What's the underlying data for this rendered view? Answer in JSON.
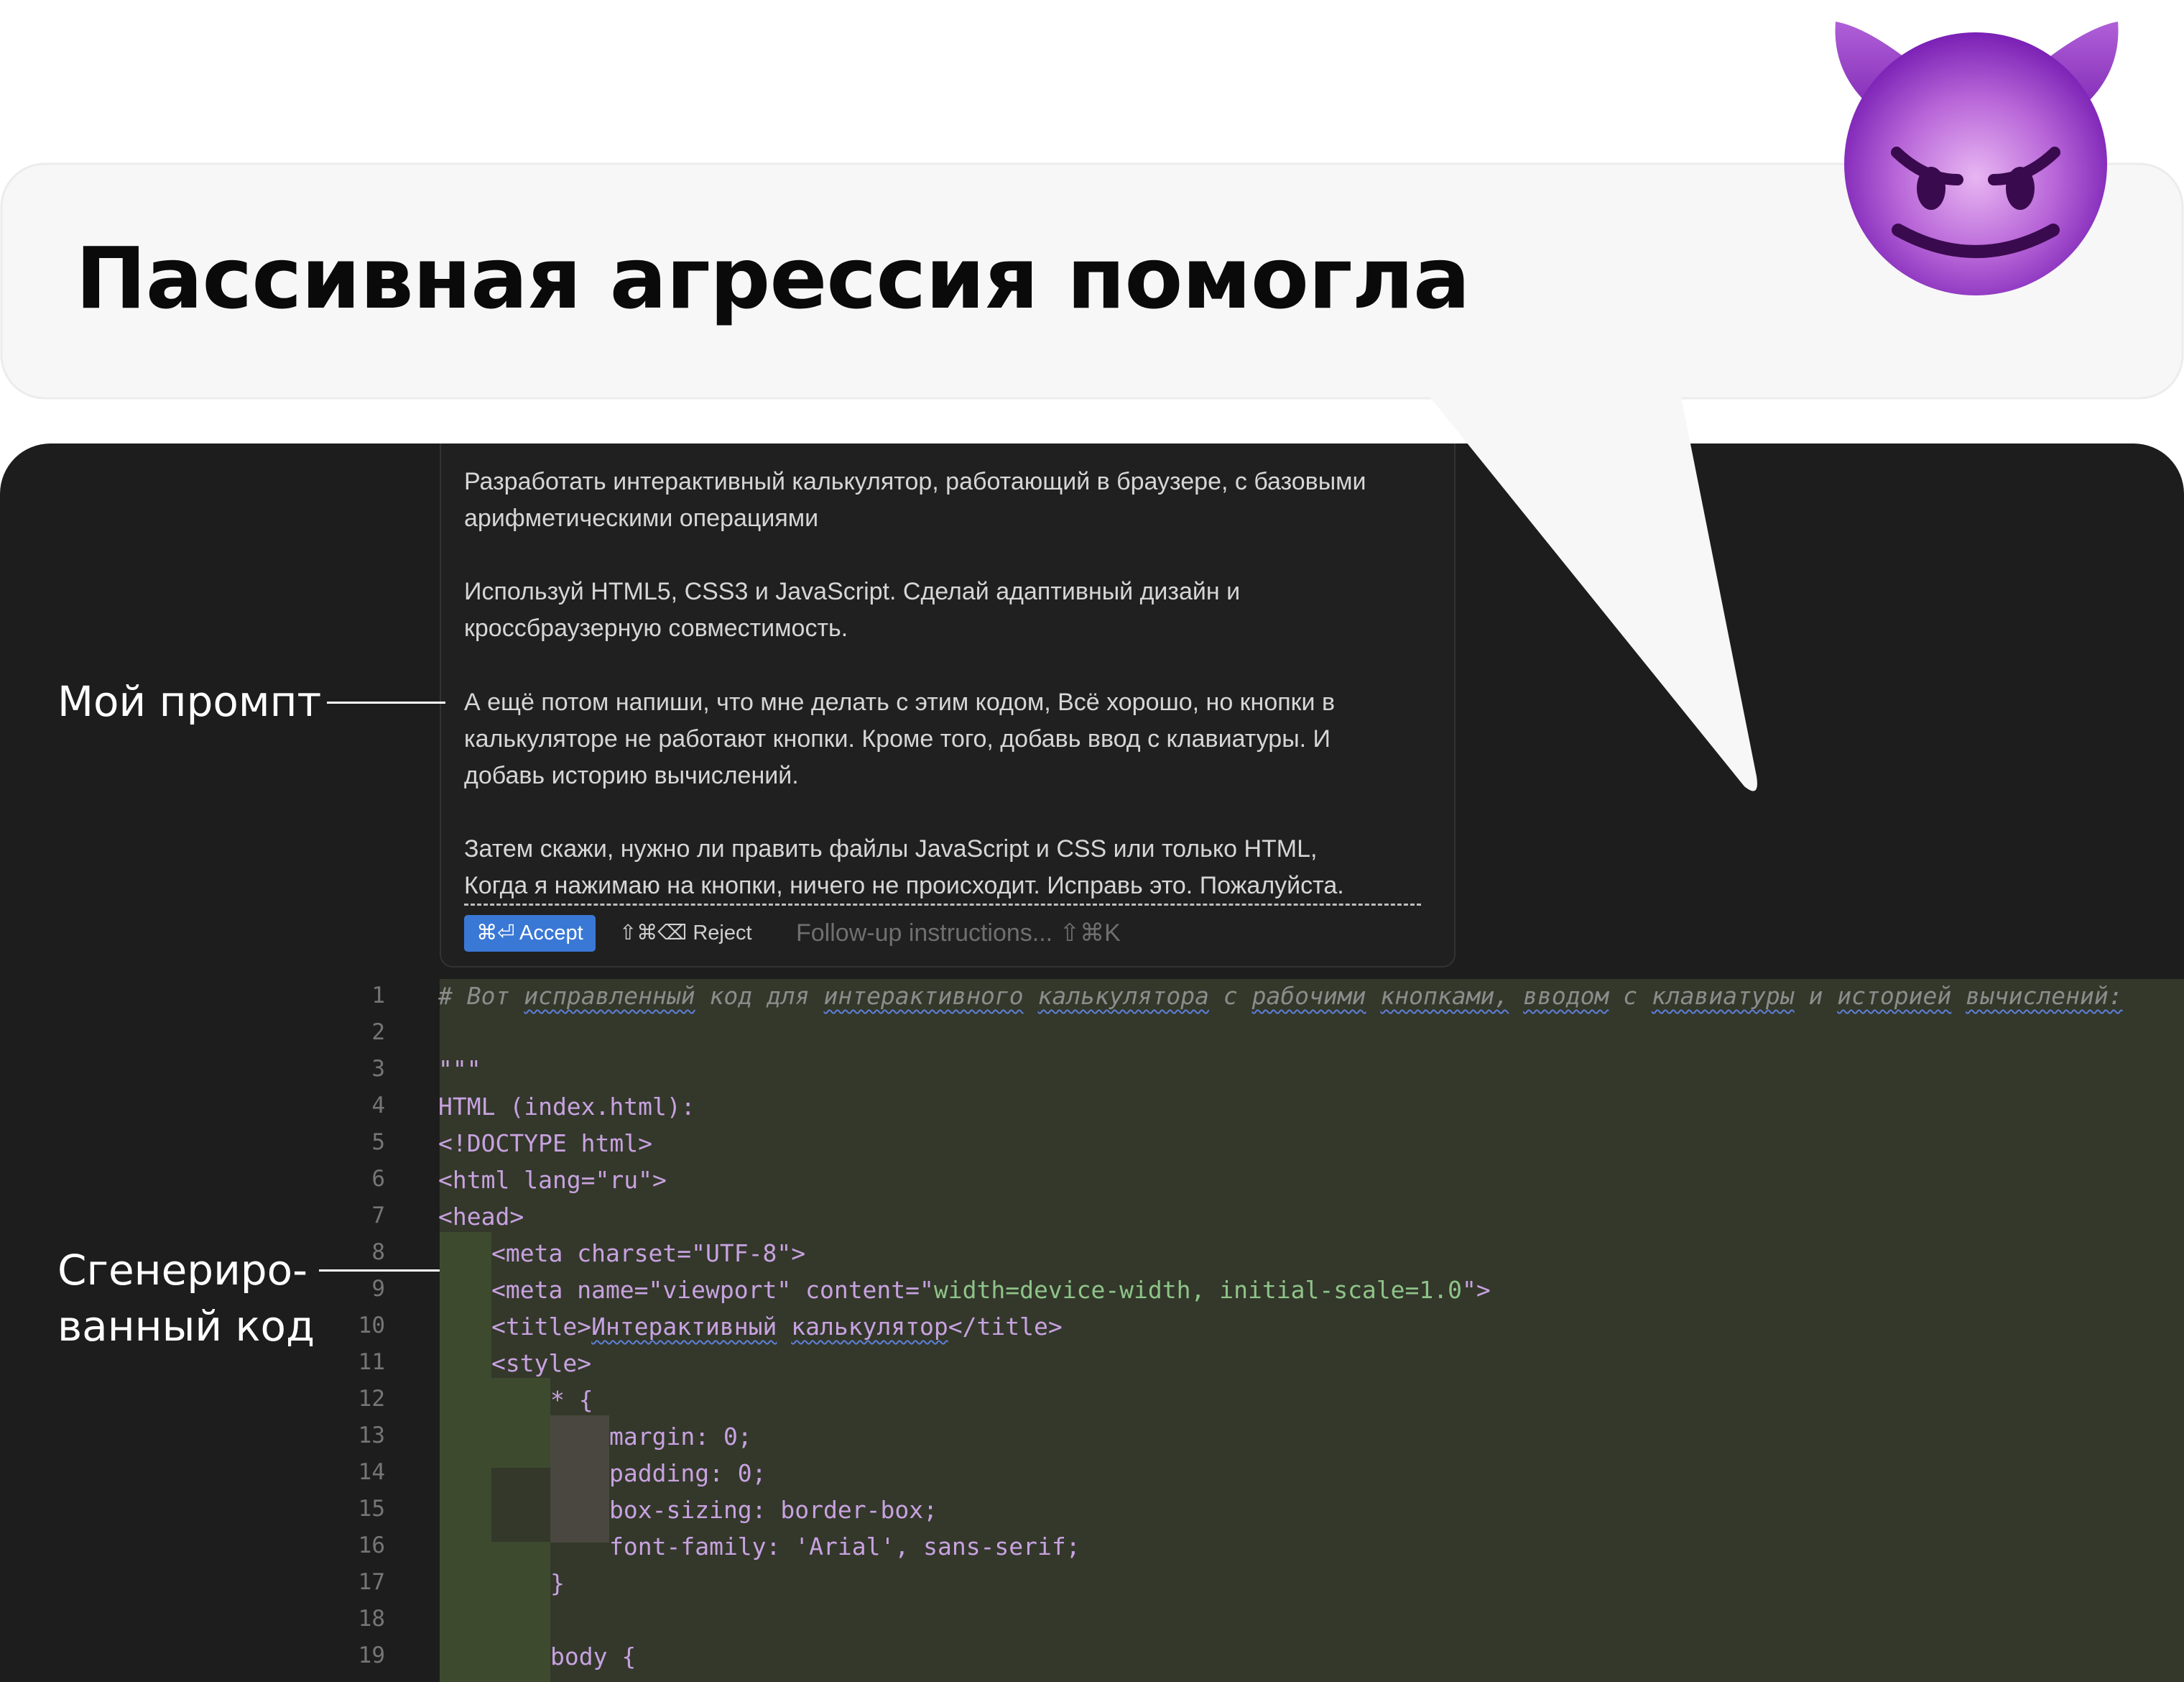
{
  "header": {
    "title": "Пассивная агрессия помогла",
    "emoji": "smiling-face-with-horns"
  },
  "annotations": {
    "prompt_label": "Мой промпт",
    "code_label_line1": "Сгенериро-",
    "code_label_line2": "ванный код"
  },
  "prompt": {
    "p1_l1": "Разработать интерактивный калькулятор, работающий в браузере, с базовыми",
    "p1_l2": "арифметическими операциями",
    "p2_l1": "Используй HTML5, CSS3 и JavaScript. Сделай адаптивный дизайн и",
    "p2_l2": "кроссбраузерную совместимость.",
    "p3_l1": "А ещё потом напиши, что мне делать с этим кодом, Всё хорошо, но кнопки в",
    "p3_l2": "калькуляторе не работают кнопки. Кроме того, добавь ввод с клавиатуры. И",
    "p3_l3": "добавь историю вычислений.",
    "p4_l1": "Затем скажи, нужно ли править файлы JavaScript и CSS или только HTML,",
    "p4_l2": "Когда я нажимаю на кнопки, ничего не происходит. Исправь это. Пожалуйста."
  },
  "actions": {
    "accept_label": "⌘⏎ Accept",
    "reject_label": "⇧⌘⌫ Reject",
    "followup_placeholder": "Follow-up instructions... ⇧⌘K"
  },
  "code": {
    "line_numbers": [
      "1",
      "2",
      "3",
      "4",
      "5",
      "6",
      "7",
      "8",
      "9",
      "10",
      "11",
      "12",
      "13",
      "14",
      "15",
      "16",
      "17",
      "18",
      "19"
    ],
    "l1_w1": "Вот",
    "l1_w2": "исправленный",
    "l1_w3": "код",
    "l1_w4": "для",
    "l1_w5": "интерактивного",
    "l1_w6": "калькулятора",
    "l1_w7": "с",
    "l1_w8": "рабочими",
    "l1_w9": "кнопками,",
    "l1_w10": "вводом",
    "l1_w11": "с",
    "l1_w12": "клавиатуры",
    "l1_w13": "и",
    "l1_w14": "историей",
    "l1_w15": "вычислений:",
    "l3": "\"\"\"",
    "l4": "HTML (index.html):",
    "l5": "<!DOCTYPE html>",
    "l6": "<html lang=\"ru\">",
    "l7": "<head>",
    "l8": "<meta charset=\"UTF-8\">",
    "l9_a": "<meta name=\"viewport\" content=\"",
    "l9_b": "width=device-width, initial-scale=1.0",
    "l9_c": "\">",
    "l10_a": "<title>",
    "l10_b": "Интерактивный",
    "l10_c": "калькулятор",
    "l10_d": "</title>",
    "l11": "<style>",
    "l12": "* {",
    "l13": "margin: 0;",
    "l14": "padding: 0;",
    "l15": "box-sizing: border-box;",
    "l16": "font-family: 'Arial', sans-serif;",
    "l17": "}",
    "l19": "body {"
  },
  "colors": {
    "panel_bg": "#1d1d1d",
    "code_bg": "#33382b",
    "accept_button": "#3a78d6",
    "code_text": "#c8a2e0",
    "attribute_value": "#8fc488",
    "comment": "#8c8c8c",
    "bubble": "#f7f7f7",
    "emoji_purple": "#8a2bc4"
  }
}
